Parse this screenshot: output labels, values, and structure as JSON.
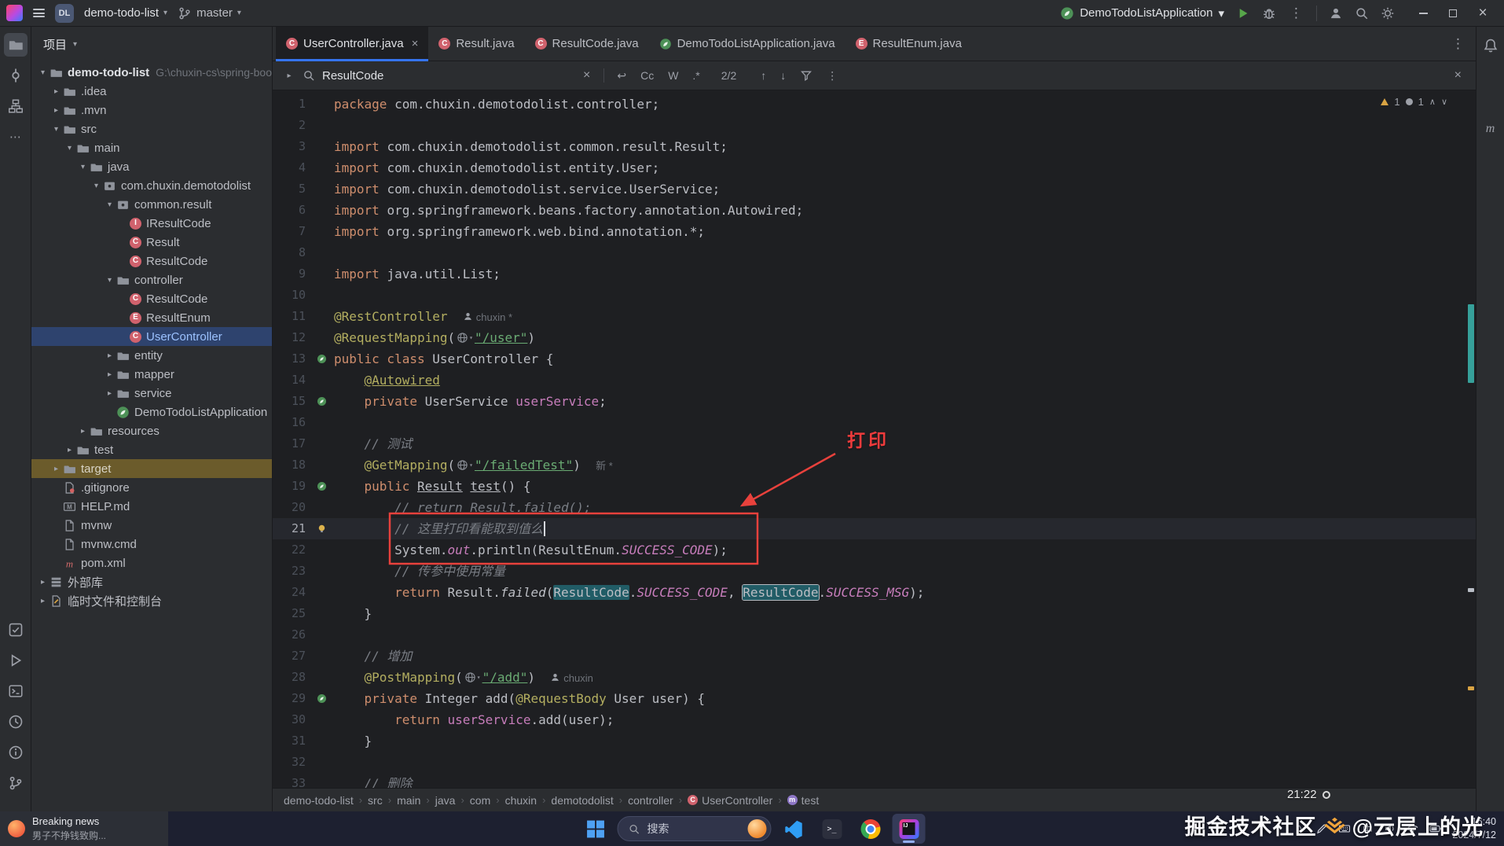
{
  "icons": {
    "chevron_down": "▾",
    "chevron_right": "▸",
    "chevron_up_small": "∧",
    "chevron_down_small": "∨",
    "more_vertical": "⋮",
    "more_horizontal": "⋯",
    "close": "×",
    "arrow_up": "↑",
    "arrow_down": "↓",
    "newline": "↩",
    "crumb_sep": "›",
    "tray_expand": "^",
    "ime": "中"
  },
  "titlebar": {
    "project_badge": "DL",
    "project_name": "demo-todo-list",
    "branch": "master",
    "run_config": "DemoTodoListApplication"
  },
  "tabbar": {
    "tabs": [
      {
        "label": "UserController.java",
        "icon": "class",
        "active": true
      },
      {
        "label": "Result.java",
        "icon": "class"
      },
      {
        "label": "ResultCode.java",
        "icon": "class"
      },
      {
        "label": "DemoTodoListApplication.java",
        "icon": "spring"
      },
      {
        "label": "ResultEnum.java",
        "icon": "enum"
      }
    ]
  },
  "left_toolbar": {
    "top": [
      {
        "name": "project",
        "icon": "folder",
        "active": true
      },
      {
        "name": "commit",
        "icon": "commit"
      },
      {
        "name": "structure",
        "icon": "structure"
      },
      {
        "name": "more-tools",
        "icon": "more"
      }
    ],
    "bottom": [
      {
        "name": "todo",
        "icon": "todo"
      },
      {
        "name": "run",
        "icon": "run"
      },
      {
        "name": "terminal",
        "icon": "terminal"
      },
      {
        "name": "history",
        "icon": "history"
      },
      {
        "name": "problems",
        "icon": "info"
      },
      {
        "name": "version-control",
        "icon": "branch"
      }
    ]
  },
  "right_toolbar": [
    {
      "name": "notifications",
      "icon": "bell"
    },
    {
      "name": "maven",
      "icon": "mavenm"
    }
  ],
  "project_panel": {
    "title": "项目",
    "tree": [
      {
        "depth": 0,
        "chevron": "open",
        "icon": "folder",
        "label": "demo-todo-list",
        "extra": "G:\\chuxin-cs\\spring-boot-",
        "state": "root"
      },
      {
        "depth": 1,
        "chevron": "closed",
        "icon": "folder",
        "label": ".idea"
      },
      {
        "depth": 1,
        "chevron": "closed",
        "icon": "folder",
        "label": ".mvn"
      },
      {
        "depth": 1,
        "chevron": "open",
        "icon": "folder",
        "label": "src"
      },
      {
        "depth": 2,
        "chevron": "open",
        "icon": "folder",
        "label": "main"
      },
      {
        "depth": 3,
        "chevron": "open",
        "icon": "folder",
        "label": "java"
      },
      {
        "depth": 4,
        "chevron": "open",
        "icon": "package",
        "label": "com.chuxin.demotodolist"
      },
      {
        "depth": 5,
        "chevron": "open",
        "icon": "package",
        "label": "common.result"
      },
      {
        "depth": 6,
        "chevron": "none",
        "icon": "interface",
        "label": "IResultCode"
      },
      {
        "depth": 6,
        "chevron": "none",
        "icon": "class",
        "label": "Result"
      },
      {
        "depth": 6,
        "chevron": "none",
        "icon": "class",
        "label": "ResultCode"
      },
      {
        "depth": 5,
        "chevron": "open",
        "icon": "folder",
        "label": "controller"
      },
      {
        "depth": 6,
        "chevron": "none",
        "icon": "class",
        "label": "ResultCode"
      },
      {
        "depth": 6,
        "chevron": "none",
        "icon": "enum",
        "label": "ResultEnum"
      },
      {
        "depth": 6,
        "chevron": "none",
        "icon": "class",
        "label": "UserController",
        "state": "selected"
      },
      {
        "depth": 5,
        "chevron": "closed",
        "icon": "folder",
        "label": "entity"
      },
      {
        "depth": 5,
        "chevron": "closed",
        "icon": "folder",
        "label": "mapper"
      },
      {
        "depth": 5,
        "chevron": "closed",
        "icon": "folder",
        "label": "service"
      },
      {
        "depth": 5,
        "chevron": "none",
        "icon": "spring",
        "label": "DemoTodoListApplication"
      },
      {
        "depth": 3,
        "chevron": "closed",
        "icon": "folder",
        "label": "resources"
      },
      {
        "depth": 2,
        "chevron": "closed",
        "icon": "folder",
        "label": "test"
      },
      {
        "depth": 1,
        "chevron": "closed",
        "icon": "folder",
        "label": "target",
        "state": "excluded"
      },
      {
        "depth": 1,
        "chevron": "none",
        "icon": "gitignore",
        "label": ".gitignore"
      },
      {
        "depth": 1,
        "chevron": "none",
        "icon": "markdown",
        "label": "HELP.md"
      },
      {
        "depth": 1,
        "chevron": "none",
        "icon": "file",
        "label": "mvnw"
      },
      {
        "depth": 1,
        "chevron": "none",
        "icon": "file",
        "label": "mvnw.cmd"
      },
      {
        "depth": 1,
        "chevron": "none",
        "icon": "maven",
        "label": "pom.xml"
      },
      {
        "depth": 0,
        "chevron": "closed",
        "icon": "library",
        "label": "外部库"
      },
      {
        "depth": 0,
        "chevron": "closed",
        "icon": "scratch",
        "label": "临时文件和控制台"
      }
    ]
  },
  "search_bar": {
    "query": "ResultCode",
    "match_case": "Cc",
    "words": "W",
    "regex": ".*",
    "count": "2/2"
  },
  "editor": {
    "inspections": {
      "warning_count": "1",
      "hint_count": "1"
    },
    "lines": [
      {
        "n": 1,
        "t": [
          [
            "k",
            "package "
          ],
          [
            "p",
            "com.chuxin.demotodolist.controller;"
          ]
        ]
      },
      {
        "n": 2,
        "t": []
      },
      {
        "n": 3,
        "t": [
          [
            "k",
            "import "
          ],
          [
            "p",
            "com.chuxin.demotodolist.common.result.Result;"
          ]
        ]
      },
      {
        "n": 4,
        "t": [
          [
            "k",
            "import "
          ],
          [
            "p",
            "com.chuxin.demotodolist.entity.User;"
          ]
        ]
      },
      {
        "n": 5,
        "t": [
          [
            "k",
            "import "
          ],
          [
            "p",
            "com.chuxin.demotodolist.service.UserService;"
          ]
        ]
      },
      {
        "n": 6,
        "t": [
          [
            "k",
            "import "
          ],
          [
            "p",
            "org.springframework.beans.factory.annotation.Autowired;"
          ]
        ]
      },
      {
        "n": 7,
        "t": [
          [
            "k",
            "import "
          ],
          [
            "p",
            "org.springframework.web.bind.annotation.*;"
          ]
        ]
      },
      {
        "n": 8,
        "t": []
      },
      {
        "n": 9,
        "t": [
          [
            "k",
            "import "
          ],
          [
            "p",
            "java.util.List;"
          ]
        ]
      },
      {
        "n": 10,
        "t": []
      },
      {
        "n": 11,
        "t": [
          [
            "a",
            "@RestController"
          ],
          [
            "p",
            "  "
          ],
          [
            "iper",
            ""
          ],
          [
            "inlay",
            "chuxin *"
          ]
        ]
      },
      {
        "n": 12,
        "t": [
          [
            "a",
            "@RequestMapping"
          ],
          [
            "p",
            "("
          ],
          [
            "iglobe",
            ""
          ],
          [
            "su",
            "\"/user\""
          ],
          [
            "p",
            ")"
          ]
        ]
      },
      {
        "n": 13,
        "g": "spring",
        "t": [
          [
            "k",
            "public class "
          ],
          [
            "p",
            "UserController {"
          ]
        ]
      },
      {
        "n": 14,
        "t": [
          [
            "p",
            "    "
          ],
          [
            "au",
            "@Autowired"
          ]
        ]
      },
      {
        "n": 15,
        "g": "spring",
        "t": [
          [
            "p",
            "    "
          ],
          [
            "k",
            "private "
          ],
          [
            "p",
            "UserService "
          ],
          [
            "f",
            "userService"
          ],
          [
            "p",
            ";"
          ]
        ]
      },
      {
        "n": 16,
        "t": []
      },
      {
        "n": 17,
        "t": [
          [
            "p",
            "    "
          ],
          [
            "c",
            "// 测试"
          ]
        ]
      },
      {
        "n": 18,
        "t": [
          [
            "p",
            "    "
          ],
          [
            "a",
            "@GetMapping"
          ],
          [
            "p",
            "("
          ],
          [
            "iglobe",
            ""
          ],
          [
            "su",
            "\"/failedTest\""
          ],
          [
            "p",
            ")"
          ],
          [
            "p",
            "  "
          ],
          [
            "inlay",
            "新 *"
          ]
        ]
      },
      {
        "n": 19,
        "g": "spring",
        "t": [
          [
            "p",
            "    "
          ],
          [
            "k",
            "public "
          ],
          [
            "mu",
            "Result"
          ],
          [
            "p",
            " "
          ],
          [
            "mu",
            "test"
          ],
          [
            "p",
            "() {"
          ]
        ]
      },
      {
        "n": 20,
        "t": [
          [
            "p",
            "        "
          ],
          [
            "c",
            "// return Result.failed();"
          ]
        ]
      },
      {
        "n": 21,
        "g": "bulb",
        "cur": true,
        "t": [
          [
            "p",
            "        "
          ],
          [
            "c",
            "// 这里打印看能取到值么"
          ],
          [
            "cursor",
            ""
          ]
        ]
      },
      {
        "n": 22,
        "t": [
          [
            "p",
            "        "
          ],
          [
            "p",
            "System."
          ],
          [
            "cn",
            "out"
          ],
          [
            "p",
            ".println(ResultEnum."
          ],
          [
            "cn",
            "SUCCESS_CODE"
          ],
          [
            "p",
            ");"
          ]
        ]
      },
      {
        "n": 23,
        "t": [
          [
            "p",
            "        "
          ],
          [
            "c",
            "// 传参中使用常量"
          ]
        ]
      },
      {
        "n": 24,
        "t": [
          [
            "p",
            "        "
          ],
          [
            "k",
            "return "
          ],
          [
            "p",
            "Result."
          ],
          [
            "sm",
            "failed"
          ],
          [
            "p",
            "("
          ],
          [
            "hl",
            "ResultCode"
          ],
          [
            "p",
            "."
          ],
          [
            "cn",
            "SUCCESS_CODE"
          ],
          [
            "p",
            ", "
          ],
          [
            "hlc",
            "ResultCode"
          ],
          [
            "p",
            "."
          ],
          [
            "cn",
            "SUCCESS_MSG"
          ],
          [
            "p",
            ");"
          ]
        ]
      },
      {
        "n": 25,
        "t": [
          [
            "p",
            "    }"
          ]
        ]
      },
      {
        "n": 26,
        "t": []
      },
      {
        "n": 27,
        "t": [
          [
            "p",
            "    "
          ],
          [
            "c",
            "// 增加"
          ]
        ]
      },
      {
        "n": 28,
        "t": [
          [
            "p",
            "    "
          ],
          [
            "a",
            "@PostMapping"
          ],
          [
            "p",
            "("
          ],
          [
            "iglobe",
            ""
          ],
          [
            "su",
            "\"/add\""
          ],
          [
            "p",
            ")"
          ],
          [
            "p",
            "  "
          ],
          [
            "iper",
            ""
          ],
          [
            "inlay",
            "chuxin"
          ]
        ]
      },
      {
        "n": 29,
        "g": "spring",
        "t": [
          [
            "p",
            "    "
          ],
          [
            "k",
            "private "
          ],
          [
            "p",
            "Integer add("
          ],
          [
            "a",
            "@RequestBody"
          ],
          [
            "p",
            " User user) {"
          ]
        ]
      },
      {
        "n": 30,
        "t": [
          [
            "p",
            "        "
          ],
          [
            "k",
            "return "
          ],
          [
            "f",
            "userService"
          ],
          [
            "p",
            ".add(user);"
          ]
        ]
      },
      {
        "n": 31,
        "t": [
          [
            "p",
            "    }"
          ]
        ]
      },
      {
        "n": 32,
        "t": []
      },
      {
        "n": 33,
        "t": [
          [
            "p",
            "    "
          ],
          [
            "c",
            "// 删除"
          ]
        ]
      }
    ]
  },
  "annotation": {
    "label": "打印"
  },
  "breadcrumbs": [
    {
      "label": "demo-todo-list"
    },
    {
      "label": "src"
    },
    {
      "label": "main"
    },
    {
      "label": "java"
    },
    {
      "label": "com"
    },
    {
      "label": "chuxin"
    },
    {
      "label": "demotodolist"
    },
    {
      "label": "controller"
    },
    {
      "label": "UserController",
      "icon": "class"
    },
    {
      "label": "test",
      "icon": "method"
    }
  ],
  "overlay": {
    "rec_time": "21:22"
  },
  "watermark": {
    "site": "掘金技术社区",
    "user": "@云层上的光"
  },
  "toast": {
    "title": "Breaking news",
    "body": "男子不挣钱致购..."
  },
  "taskbar": {
    "search_placeholder": "搜索",
    "apps": [
      {
        "name": "vscode"
      },
      {
        "name": "terminal"
      },
      {
        "name": "chrome"
      },
      {
        "name": "idea",
        "active": true
      }
    ],
    "tray": [
      "tray-expand",
      "pen",
      "keyboard",
      "ime",
      "speaker",
      "wifi",
      "battery"
    ],
    "clock": {
      "time": "16:40",
      "date": "2024/7/12"
    }
  }
}
